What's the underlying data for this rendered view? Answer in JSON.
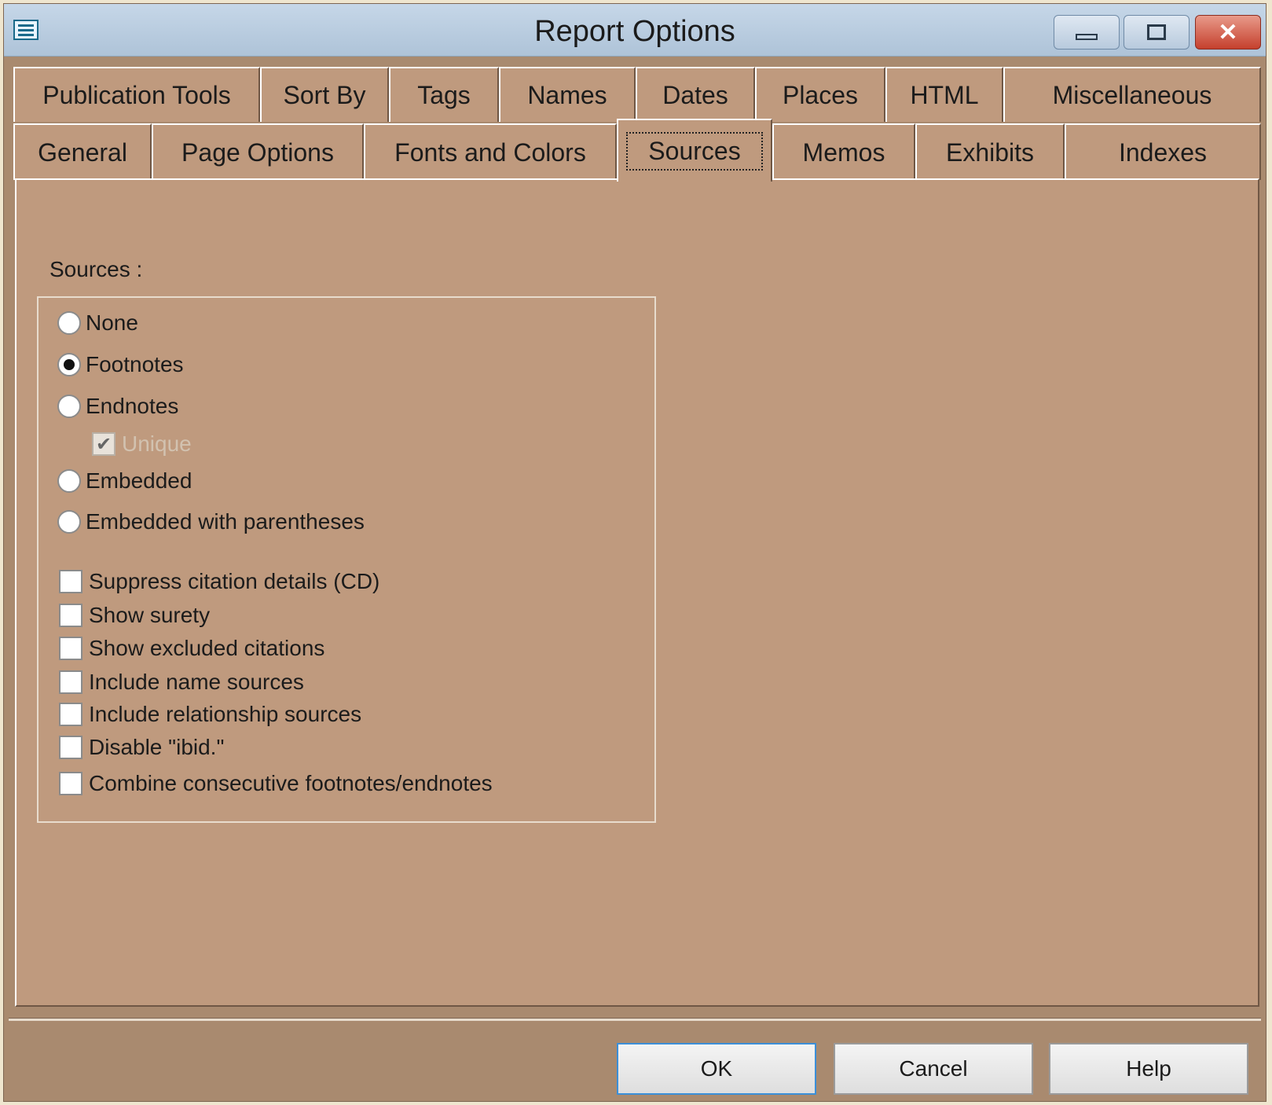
{
  "window": {
    "title": "Report Options"
  },
  "tabs_row1": [
    "Publication Tools",
    "Sort By",
    "Tags",
    "Names",
    "Dates",
    "Places",
    "HTML",
    "Miscellaneous"
  ],
  "tabs_row2": [
    "General",
    "Page Options",
    "Fonts and Colors",
    "Sources",
    "Memos",
    "Exhibits",
    "Indexes"
  ],
  "active_tab": "Sources",
  "sources": {
    "group_label": "Sources :",
    "radios": [
      {
        "label": "None",
        "checked": false
      },
      {
        "label": "Footnotes",
        "checked": true
      },
      {
        "label": "Endnotes",
        "checked": false
      },
      {
        "label": "Embedded",
        "checked": false
      },
      {
        "label": "Embedded with parentheses",
        "checked": false
      }
    ],
    "unique": {
      "label": "Unique",
      "checked": true,
      "disabled": true
    },
    "checkboxes": [
      {
        "label": "Suppress citation details (CD)",
        "checked": false
      },
      {
        "label": "Show surety",
        "checked": false
      },
      {
        "label": "Show excluded citations",
        "checked": false
      },
      {
        "label": "Include name sources",
        "checked": false
      },
      {
        "label": "Include relationship sources",
        "checked": false
      },
      {
        "label": "Disable \"ibid.\"",
        "checked": false
      },
      {
        "label": "Combine consecutive footnotes/endnotes",
        "checked": false
      }
    ]
  },
  "buttons": {
    "ok": "OK",
    "cancel": "Cancel",
    "help": "Help"
  },
  "colors": {
    "dialog_bg": "#bf9a7e",
    "titlebar": "#b8cadd",
    "close_button": "#c5402d"
  }
}
